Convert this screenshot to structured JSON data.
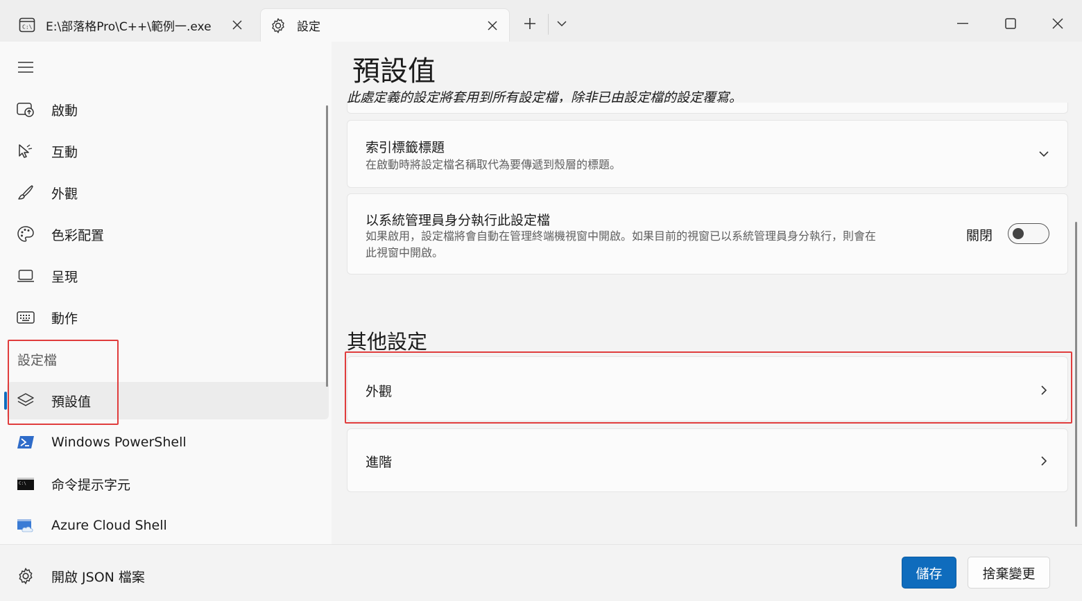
{
  "tabs": [
    {
      "label": "E:\\部落格Pro\\C++\\範例一.exe",
      "icon": "console-icon"
    },
    {
      "label": "設定",
      "icon": "gear-icon"
    }
  ],
  "sidebar": {
    "items": [
      {
        "label": "啟動",
        "icon": "startup-icon"
      },
      {
        "label": "互動",
        "icon": "cursor-icon"
      },
      {
        "label": "外觀",
        "icon": "brush-icon"
      },
      {
        "label": "色彩配置",
        "icon": "palette-icon"
      },
      {
        "label": "呈現",
        "icon": "laptop-icon"
      },
      {
        "label": "動作",
        "icon": "keyboard-icon"
      }
    ],
    "profiles_header": "設定檔",
    "profiles": [
      {
        "label": "預設值",
        "icon": "layers-icon",
        "selected": true
      },
      {
        "label": "Windows PowerShell",
        "icon": "powershell-icon"
      },
      {
        "label": "命令提示字元",
        "icon": "cmd-icon"
      },
      {
        "label": "Azure Cloud Shell",
        "icon": "azure-cloud-icon"
      }
    ]
  },
  "bottom": {
    "open_json": "開啟 JSON 檔案",
    "save": "儲存",
    "discard": "捨棄變更"
  },
  "main": {
    "title": "預設值",
    "description": "此處定義的設定將套用到所有設定檔，除非已由設定檔的設定覆寫。",
    "cards": [
      {
        "title": "索引標籤標題",
        "subtitle": "在啟動時將設定檔名稱取代為要傳遞到殼層的標題。"
      },
      {
        "title": "以系統管理員身分執行此設定檔",
        "subtitle_line1": "如果啟用，設定檔將會自動在管理終端機視窗中開啟。如果目前的視窗已以系統管理員身分執行，則會在",
        "subtitle_line2": "此視窗中開啟。",
        "toggle_label": "關閉",
        "toggle_on": false
      }
    ],
    "other_section": "其他設定",
    "other_items": [
      {
        "label": "外觀"
      },
      {
        "label": "進階"
      }
    ]
  },
  "colors": {
    "accent": "#0f6cbd",
    "highlight": "#e03c3c"
  }
}
